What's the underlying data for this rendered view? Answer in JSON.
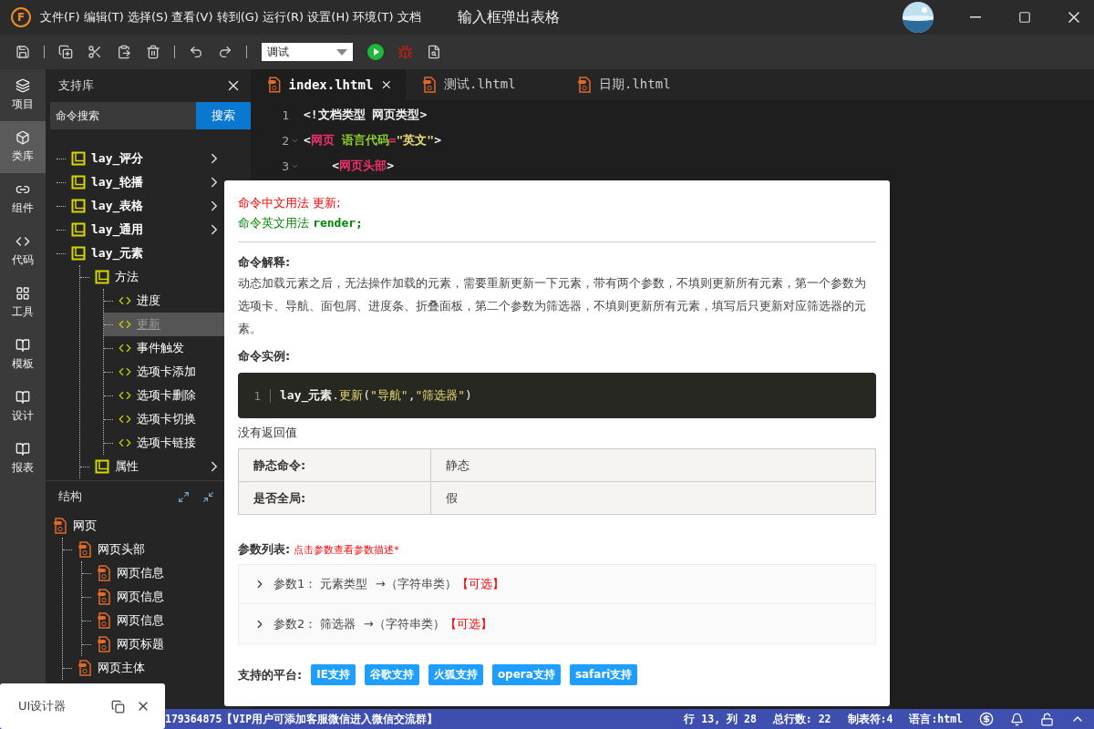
{
  "window": {
    "logo": "F",
    "menu": "文件(F) 编辑(T) 选择(S) 查看(V) 转到(G) 运行(R) 设置(H) 环境(T) 文档",
    "title": "输入框弹出表格"
  },
  "toolbar": {
    "mode": "调试"
  },
  "activity_bar": [
    {
      "label": "项目",
      "selected": false
    },
    {
      "label": "类库",
      "selected": true
    },
    {
      "label": "组件",
      "selected": false
    },
    {
      "label": "代码",
      "selected": false
    },
    {
      "label": "工具",
      "selected": false
    },
    {
      "label": "模板",
      "selected": false
    },
    {
      "label": "设计",
      "selected": false
    },
    {
      "label": "报表",
      "selected": false
    }
  ],
  "library": {
    "title": "支持库",
    "search": {
      "value": "命令搜索",
      "button": "搜索"
    },
    "tree": [
      {
        "label": "lay_评分",
        "kind": "folder",
        "expanded": false
      },
      {
        "label": "lay_轮播",
        "kind": "folder",
        "expanded": false
      },
      {
        "label": "lay_表格",
        "kind": "folder",
        "expanded": false
      },
      {
        "label": "lay_通用",
        "kind": "folder",
        "expanded": false
      },
      {
        "label": "lay_元素",
        "kind": "folder",
        "expanded": true,
        "children": [
          {
            "label": "方法",
            "kind": "folder",
            "expanded": true,
            "children": [
              {
                "label": "进度",
                "kind": "method",
                "selected": false
              },
              {
                "label": "更新",
                "kind": "method",
                "selected": true
              },
              {
                "label": "事件触发",
                "kind": "method",
                "selected": false
              },
              {
                "label": "选项卡添加",
                "kind": "method",
                "selected": false
              },
              {
                "label": "选项卡删除",
                "kind": "method",
                "selected": false
              },
              {
                "label": "选项卡切换",
                "kind": "method",
                "selected": false
              },
              {
                "label": "选项卡链接",
                "kind": "method",
                "selected": false
              }
            ]
          },
          {
            "label": "属性",
            "kind": "folder",
            "expanded": false
          }
        ]
      }
    ]
  },
  "structure": {
    "title": "结构",
    "tree": [
      {
        "label": "网页",
        "children": [
          {
            "label": "网页头部",
            "children": [
              {
                "label": "网页信息"
              },
              {
                "label": "网页信息"
              },
              {
                "label": "网页信息"
              },
              {
                "label": "网页标题"
              }
            ]
          },
          {
            "label": "网页主体"
          }
        ]
      }
    ]
  },
  "editor": {
    "tabs": [
      {
        "label": "index.lhtml",
        "selected": true
      },
      {
        "label": "测试.lhtml",
        "selected": false
      },
      {
        "label": "日期.lhtml",
        "selected": false
      }
    ],
    "lines": [
      {
        "number": "1",
        "fold": false,
        "tokens": [
          {
            "kind": "punct",
            "text": "<!文档类型 网页类型>"
          }
        ]
      },
      {
        "number": "2",
        "fold": true,
        "tokens": [
          {
            "kind": "punct",
            "text": "<"
          },
          {
            "kind": "tag",
            "text": "网页"
          },
          {
            "kind": "attr",
            "text": " 语言代码"
          },
          {
            "kind": "op",
            "text": "="
          },
          {
            "kind": "string",
            "text": "\"英文\""
          },
          {
            "kind": "punct",
            "text": ">"
          }
        ]
      },
      {
        "number": "3",
        "fold": true,
        "tokens": [
          {
            "kind": "punct",
            "text": "    <"
          },
          {
            "kind": "tag",
            "text": "网页头部"
          },
          {
            "kind": "punct",
            "text": ">"
          }
        ]
      }
    ]
  },
  "popup": {
    "usage_cn": "命令中文用法  更新;",
    "usage_en_label": "命令英文用法 ",
    "usage_en": "render;",
    "explain_title": "命令解释:",
    "explain": "动态加载元素之后，无法操作加载的元素，需要重新更新一下元素，带有两个参数，不填则更新所有元素，第一个参数为选项卡、导航、面包屑、进度条、折叠面板，第二个参数为筛选器，不填则更新所有元素，填写后只更新对应筛选器的元素。",
    "example_title": "命令实例:",
    "example": {
      "number": "1",
      "tokens": [
        {
          "kind": "plain",
          "text": "lay_元素"
        },
        {
          "kind": "punct",
          "text": "."
        },
        {
          "kind": "func",
          "text": "更新"
        },
        {
          "kind": "punct",
          "text": "("
        },
        {
          "kind": "string",
          "text": "\"导航\""
        },
        {
          "kind": "punct",
          "text": ","
        },
        {
          "kind": "string",
          "text": "\"筛选器\""
        },
        {
          "kind": "punct",
          "text": ")"
        }
      ]
    },
    "returns": "没有返回值",
    "properties": [
      {
        "name": "静态命令:",
        "value": "静态"
      },
      {
        "name": "是否全局:",
        "value": "假"
      }
    ],
    "params_title": "参数列表:",
    "params_hint": "点击参数查看参数描述*",
    "params": [
      {
        "text": "参数1： 元素类型  →（字符串类）",
        "flag": "【可选】",
        "expanded": false
      },
      {
        "text": "参数2： 筛选器  →（字符串类）",
        "flag": "【可选】",
        "expanded": false
      }
    ],
    "platforms_title": "支持的平台:",
    "platforms": [
      "IE支持",
      "谷歌支持",
      "火狐支持",
      "opera支持",
      "safari支持"
    ]
  },
  "designer": {
    "title": "UI设计器"
  },
  "status_bar": {
    "message": "179364875【VIP用户可添加客服微信进入微信交流群】",
    "position": "行 13, 列 28",
    "lines": "总行数: 22",
    "tab": "制表符:4",
    "language": "语言:html"
  }
}
